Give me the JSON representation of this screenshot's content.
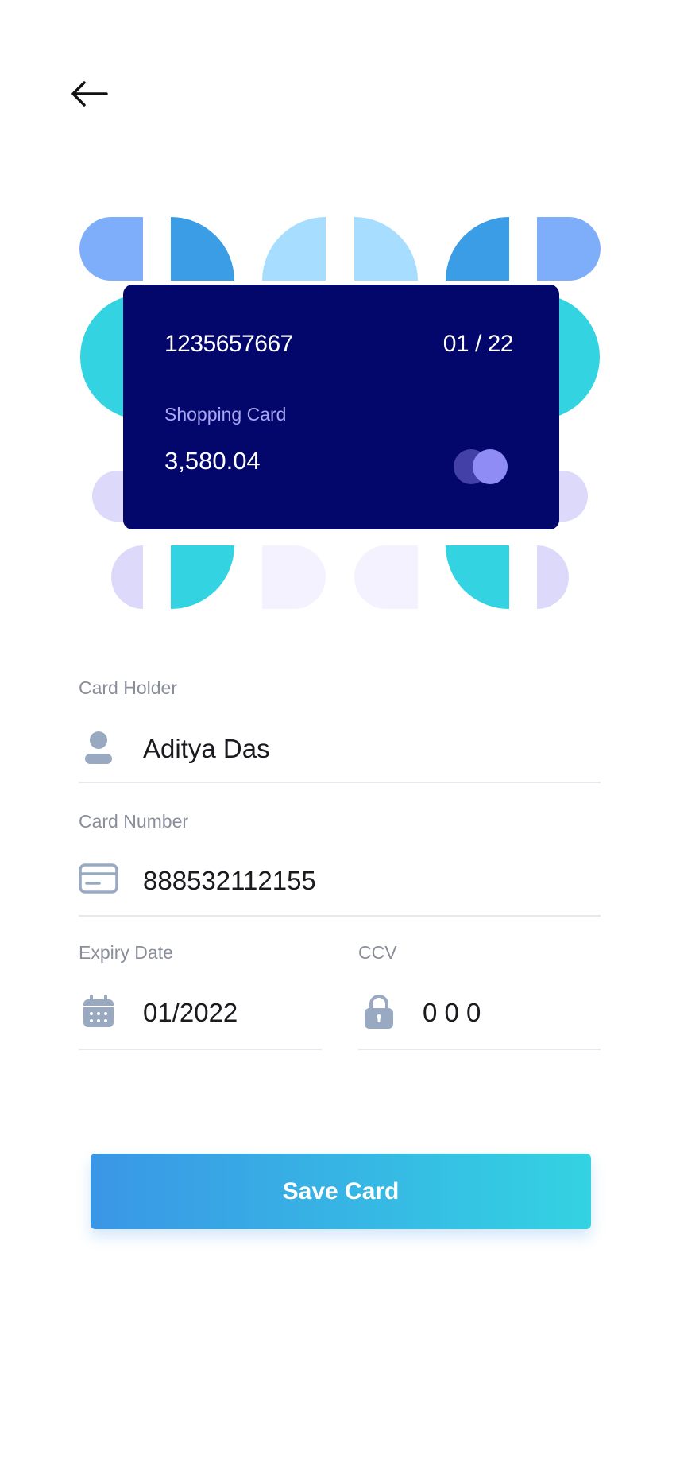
{
  "nav": {
    "back_icon": "arrow-left-icon"
  },
  "card": {
    "number": "1235657667",
    "expiry": "01 / 22",
    "name": "Shopping Card",
    "balance": "3,580.04",
    "background": "#03066b",
    "logo_icon": "card-brand-circles-icon"
  },
  "form": {
    "card_holder": {
      "label": "Card Holder",
      "value": "Aditya Das",
      "icon": "user-icon"
    },
    "card_number": {
      "label": "Card Number",
      "value": "888532112155",
      "icon": "credit-card-icon"
    },
    "expiry_date": {
      "label": "Expiry Date",
      "value": "01/2022",
      "icon": "calendar-icon"
    },
    "ccv": {
      "label": "CCV",
      "value": "0 0 0",
      "icon": "lock-icon"
    }
  },
  "save_button": {
    "label": "Save Card",
    "gradient_start": "#3a96e6",
    "gradient_end": "#33d3e2"
  },
  "colors": {
    "light_blue": "#7eaef9",
    "blue": "#3a9de6",
    "sky": "#a7ddfe",
    "cyan": "#33d3e2",
    "lavender": "#ddd9fb",
    "pale_lavender": "#f3f2fe",
    "label_gray": "#8a8d9a",
    "icon_gray": "#99a9c2"
  }
}
